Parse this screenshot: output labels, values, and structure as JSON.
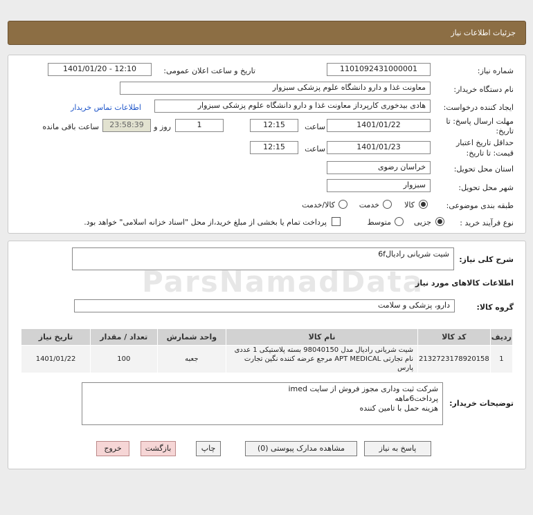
{
  "header": {
    "title": "جزئیات اطلاعات نیاز"
  },
  "form": {
    "need_number_label": "شماره نیاز:",
    "need_number": "1101092431000001",
    "announce_label": "تاریخ و ساعت اعلان عمومی:",
    "announce_value": "1401/01/20 - 12:10",
    "buyer_org_label": "نام دستگاه خریدار:",
    "buyer_org": "معاونت غذا و دارو   دانشگاه علوم پزشکی سبزوار",
    "creator_label": "ایجاد کننده درخواست:",
    "creator": "هادی بیدخوری کارپرداز معاونت غذا و دارو   دانشگاه علوم پزشکی سبزوار",
    "contact_link": "اطلاعات تماس خریدار",
    "deadline_label_1": "مهلت ارسال پاسخ: تا",
    "deadline_label_2": "تاریخ:",
    "deadline_date": "1401/01/22",
    "time_label": "ساعت",
    "deadline_time": "12:15",
    "day_label": "روز و",
    "days_value": "1",
    "remaining_time": "23:58:39",
    "remaining_label": "ساعت باقی مانده",
    "validity_label_1": "حداقل تاریخ اعتبار",
    "validity_label_2": "قیمت: تا تاریخ:",
    "validity_date": "1401/01/23",
    "validity_time": "12:15",
    "province_label": "استان محل تحویل:",
    "province": "خراسان رضوی",
    "city_label": "شهر محل تحویل:",
    "city": "سبزوار",
    "category_label": "طبقه بندی موضوعی:",
    "category_options": [
      "کالا",
      "خدمت",
      "کالا/خدمت"
    ],
    "category_selected": "کالا",
    "process_label": "نوع فرآیند خرید :",
    "process_options": [
      "جزیی",
      "متوسط"
    ],
    "process_selected": "جزیی",
    "payment_note": "پرداخت تمام یا بخشی از مبلغ خرید،از محل \"اسناد خزانه اسلامی\" خواهد بود."
  },
  "summary": {
    "need_desc_label": "شرح کلی نیاز:",
    "need_desc": "شیت شریانی رادیال6f",
    "goods_info_title": "اطلاعات کالاهای مورد نیاز",
    "goods_group_label": "گروه کالا:",
    "goods_group": "دارو، پزشکی و سلامت",
    "watermark": "ParsNamadData"
  },
  "table": {
    "headers": [
      "ردیف",
      "کد کالا",
      "نام کالا",
      "واحد شمارش",
      "تعداد / مقدار",
      "تاریخ نیاز"
    ],
    "rows": [
      [
        "1",
        "2132723178920158",
        "شیت شریانی رادیال مدل 98040150 بسته پلاستیکی 1 عددی نام تجارتی APT MEDICAL مرجع عرضه کننده نگین تجارت پارس",
        "جعبه",
        "100",
        "1401/01/22"
      ]
    ]
  },
  "buyer_notes": {
    "label": "توضیحات خریدار:",
    "lines": [
      "شرکت ثبت وداری مجوز فروش از سایت imed",
      "پرداخت6ماهه",
      "هزینه حمل با تامین کننده"
    ]
  },
  "buttons": {
    "reply": "پاسخ به نیاز",
    "view_docs": "مشاهده مدارک پیوستی (0)",
    "print": "چاپ",
    "back": "بازگشت",
    "exit": "خروج"
  }
}
